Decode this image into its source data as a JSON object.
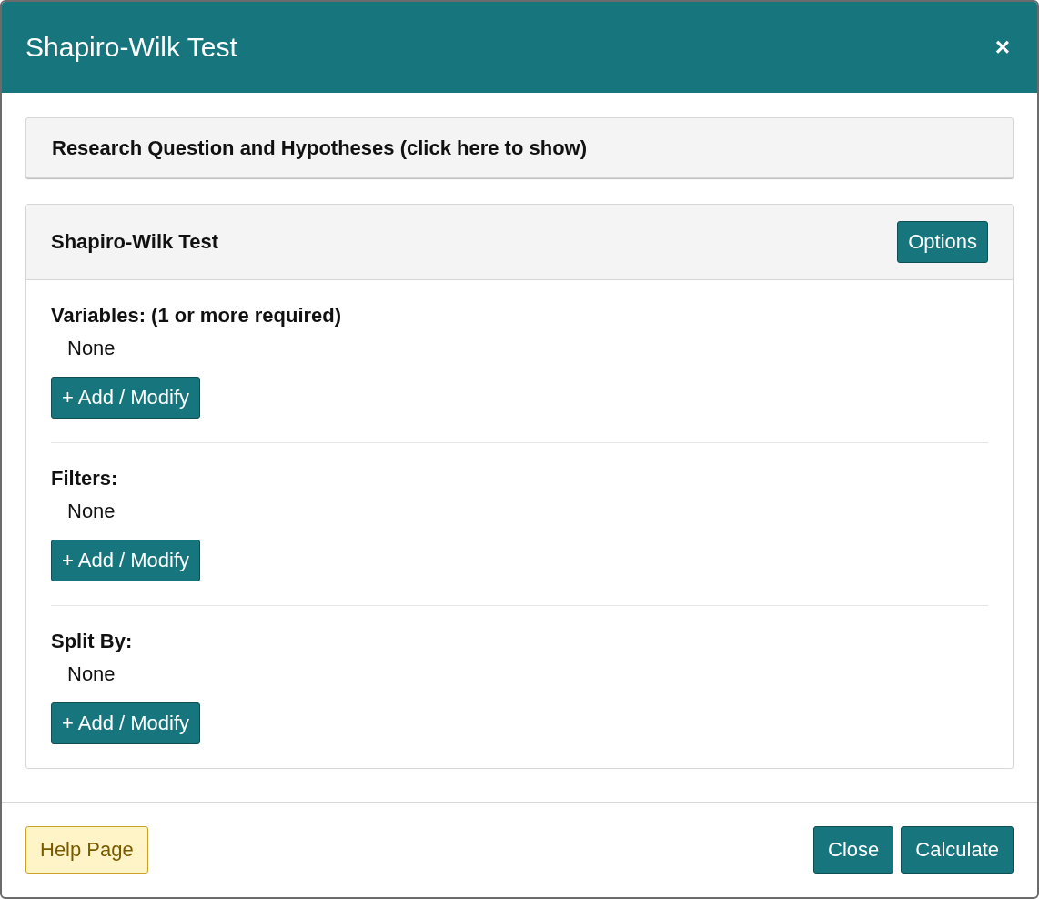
{
  "dialog": {
    "title": "Shapiro-Wilk Test",
    "close": "×"
  },
  "collapsed_panel": {
    "title": "Research Question and Hypotheses (click here to show)"
  },
  "panel": {
    "title": "Shapiro-Wilk Test",
    "options_button": "Options",
    "sections": [
      {
        "label": "Variables: (1 or more required)",
        "value": "None",
        "button": "+ Add / Modify"
      },
      {
        "label": "Filters:",
        "value": "None",
        "button": "+ Add / Modify"
      },
      {
        "label": "Split By:",
        "value": "None",
        "button": "+ Add / Modify"
      }
    ]
  },
  "footer": {
    "help_button": "Help Page",
    "buttons": [
      "Close",
      "Calculate"
    ]
  }
}
